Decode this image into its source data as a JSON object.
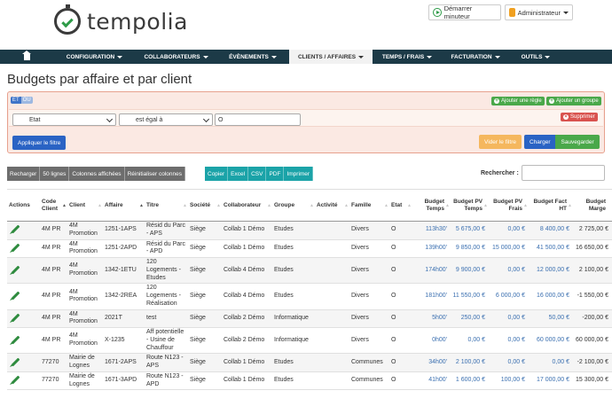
{
  "brand": {
    "name": "tempolia"
  },
  "header": {
    "timer_label": "Démarrer minuteur",
    "user_label": "Administrateur"
  },
  "nav": {
    "items": [
      {
        "label": "CONFIGURATION",
        "dropdown": true
      },
      {
        "label": "COLLABORATEURS",
        "dropdown": true
      },
      {
        "label": "ÉVÈNEMENTS",
        "dropdown": true
      },
      {
        "label": "CLIENTS / AFFAIRES",
        "dropdown": true,
        "active": true
      },
      {
        "label": "TEMPS / FRAIS",
        "dropdown": true
      },
      {
        "label": "FACTURATION",
        "dropdown": true
      },
      {
        "label": "OUTILS",
        "dropdown": true
      }
    ]
  },
  "page": {
    "title": "Budgets par affaire et par client"
  },
  "filter": {
    "logic_on": "ET",
    "logic_off": "OU",
    "add_rule": "Ajouter une règle",
    "add_group": "Ajouter un groupe",
    "field": "Etat",
    "operator": "est égal à",
    "value": "O",
    "delete": "Supprimer",
    "apply": "Appliquer le filtre",
    "view_filter": "Vider le filtre",
    "load": "Charger",
    "save": "Sauvegarder"
  },
  "toolbar": {
    "left": [
      "Recharger",
      "50 lignes",
      "Colonnes affichées",
      "Réinitialiser colonnes"
    ],
    "export": [
      "Copier",
      "Excel",
      "CSV",
      "PDF",
      "Imprimer"
    ],
    "search_label": "Rechercher :"
  },
  "table": {
    "columns": [
      "Actions",
      "Code Client",
      "Client",
      "Affaire",
      "Titre",
      "Société",
      "Collaborateur",
      "Groupe",
      "Activité",
      "Famille",
      "Etat",
      "Budget Temps",
      "Budget PV Temps",
      "Budget PV Frais",
      "Budget Fact HT",
      "Budget Marge"
    ],
    "rows": [
      [
        "4M PR",
        "4M Promotion",
        "1251-1APS",
        "Résid du Parc - APS",
        "Siège",
        "Collab 1 Démo",
        "Etudes",
        "",
        "Divers",
        "O",
        "113h30'",
        "5 675,00 €",
        "0,00 €",
        "8 400,00 €",
        "2 725,00 €"
      ],
      [
        "4M PR",
        "4M Promotion",
        "1251-2APD",
        "Résid du Parc - APD",
        "Siège",
        "Collab 1 Démo",
        "Etudes",
        "",
        "Divers",
        "O",
        "139h00'",
        "9 850,00 €",
        "15 000,00 €",
        "41 500,00 €",
        "16 650,00 €"
      ],
      [
        "4M PR",
        "4M Promotion",
        "1342-1ETU",
        "120 Logements - Etudes",
        "Siège",
        "Collab 4 Démo",
        "Etudes",
        "",
        "Divers",
        "O",
        "174h00'",
        "9 900,00 €",
        "0,00 €",
        "12 000,00 €",
        "2 100,00 €"
      ],
      [
        "4M PR",
        "4M Promotion",
        "1342-2REA",
        "120 Logements - Réalisation",
        "Siège",
        "Collab 4 Démo",
        "Etudes",
        "",
        "Divers",
        "O",
        "181h00'",
        "11 550,00 €",
        "6 000,00 €",
        "16 000,00 €",
        "-1 550,00 €"
      ],
      [
        "4M PR",
        "4M Promotion",
        "2021T",
        "test",
        "Siège",
        "Collab 2 Démo",
        "Informatique",
        "",
        "Divers",
        "O",
        "5h00'",
        "250,00 €",
        "0,00 €",
        "50,00 €",
        "-200,00 €"
      ],
      [
        "4M PR",
        "4M Promotion",
        "X-1235",
        "Aff potentielle - Usine de Chauffour",
        "Siège",
        "Collab 2 Démo",
        "Informatique",
        "",
        "Divers",
        "O",
        "0h00'",
        "0,00 €",
        "0,00 €",
        "60 000,00 €",
        "60 000,00 €"
      ],
      [
        "77270",
        "Mairie de Lognes",
        "1671-2APS",
        "Route N123 - APS",
        "Siège",
        "Collab 1 Démo",
        "Etudes",
        "",
        "Communes",
        "O",
        "34h00'",
        "2 100,00 €",
        "0,00 €",
        "0,00 €",
        "-2 100,00 €"
      ],
      [
        "77270",
        "Mairie de Lognes",
        "1671-3APD",
        "Route N123 - APD",
        "Siège",
        "Collab 1 Démo",
        "Etudes",
        "",
        "Communes",
        "O",
        "41h00'",
        "1 600,00 €",
        "100,00 €",
        "17 000,00 €",
        "15 300,00 €"
      ]
    ]
  }
}
